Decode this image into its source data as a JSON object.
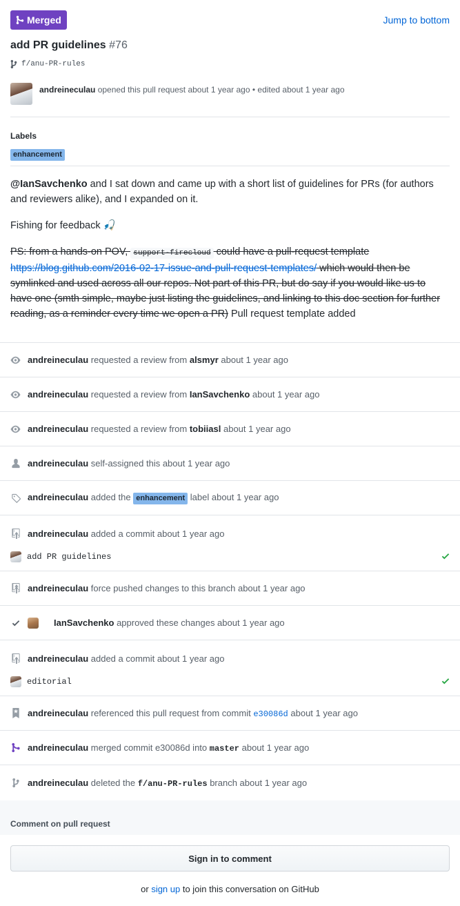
{
  "header": {
    "state_badge": "Merged",
    "jump_link": "Jump to bottom",
    "title": "add PR guidelines",
    "number": "#76",
    "branch": "f/anu-PR-rules",
    "opener": {
      "user": "andreineculau",
      "text": "opened this pull request about 1 year ago • edited about 1 year ago"
    }
  },
  "labels": {
    "heading": "Labels",
    "items": [
      "enhancement"
    ]
  },
  "body": {
    "p1_mention": "@IanSavchenko",
    "p1_text": " and I sat down and came up with a short list of guidelines for PRs (for authors and reviewers alike), and I expanded on it.",
    "p2_text": "Fishing for feedback ",
    "p2_emoji": "🎣",
    "p3_strike1": "PS: from a hands-on POV, ",
    "p3_code": "support-firecloud",
    "p3_strike2": " could have a pull-request template ",
    "p3_link": "https://blog.github.com/2016-02-17-issue-and-pull-request-templates/",
    "p3_strike3": " which would then be symlinked and used across all our repos. Not part of this PR, but do say if you would like us to have one (smth simple, maybe just listing the guidelines, and linking to this doc section for further reading, as a reminder every time we open a PR)",
    "p3_tail": " Pull request template added"
  },
  "timeline": [
    {
      "icon": "eye-icon",
      "actor": "andreineculau",
      "text": "requested a review from",
      "target": "alsmyr",
      "time": "about 1 year ago"
    },
    {
      "icon": "eye-icon",
      "actor": "andreineculau",
      "text": "requested a review from",
      "target": "IanSavchenko",
      "time": "about 1 year ago"
    },
    {
      "icon": "eye-icon",
      "actor": "andreineculau",
      "text": "requested a review from",
      "target": "tobiiasl",
      "time": "about 1 year ago"
    },
    {
      "icon": "person-icon",
      "actor": "andreineculau",
      "text": "self-assigned this about 1 year ago"
    },
    {
      "icon": "tag-icon",
      "actor": "andreineculau",
      "text": "added the",
      "label": "enhancement",
      "text2": "label about 1 year ago"
    },
    {
      "icon": "repo-push-icon",
      "actor": "andreineculau",
      "text": "added a commit about 1 year ago",
      "commit_message": "add PR guidelines"
    },
    {
      "icon": "repo-push-icon",
      "actor": "andreineculau",
      "text": "force pushed changes to this branch about 1 year ago"
    },
    {
      "icon": "check-icon",
      "actor": "IanSavchenko",
      "text": "approved these changes about 1 year ago"
    },
    {
      "icon": "repo-push-icon",
      "actor": "andreineculau",
      "text": "added a commit about 1 year ago",
      "commit_message": "editorial"
    },
    {
      "icon": "bookmark-icon",
      "actor": "andreineculau",
      "text": "referenced this pull request from commit",
      "sha": "e30086d",
      "time": "about 1 year ago"
    },
    {
      "icon": "merge-icon",
      "actor": "andreineculau",
      "text": "merged commit e30086d into",
      "branch": "master",
      "time": "about 1 year ago"
    },
    {
      "icon": "branch-icon",
      "actor": "andreineculau",
      "text": "deleted the",
      "branch": "f/anu-PR-rules",
      "text2": "branch about 1 year ago"
    }
  ],
  "comment": {
    "heading": "Comment on pull request",
    "sign_in_button": "Sign in to comment",
    "or_prefix": "or ",
    "sign_up_link": "sign up",
    "or_suffix": " to join this conversation on GitHub"
  },
  "colors": {
    "merged": "#6f42c1",
    "link": "#0366d6",
    "label_bg": "#84b6eb",
    "success": "#28a745"
  }
}
